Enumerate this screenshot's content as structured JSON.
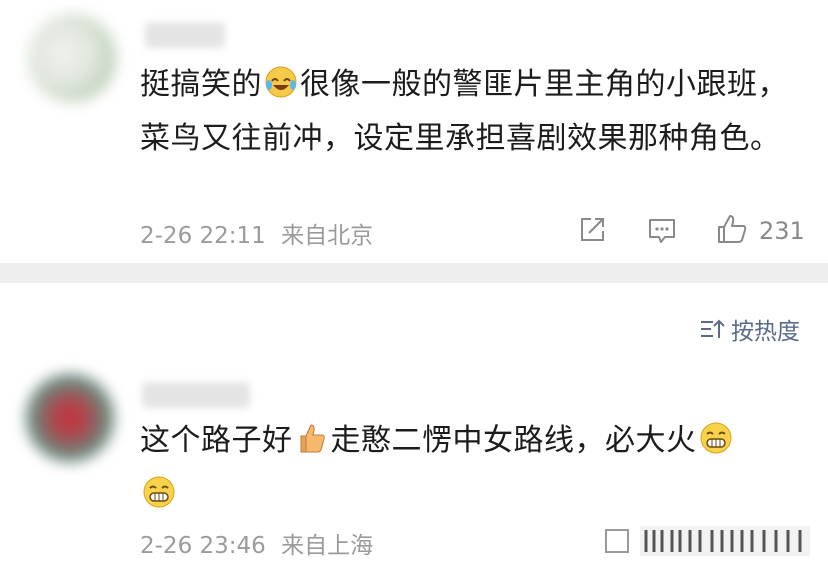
{
  "comments": [
    {
      "text_part1": "挺搞笑的",
      "text_part2": "很像一般的警匪片里主角的小跟班，菜鸟又往前冲，设定里承担喜剧效果那种角色。",
      "time": "2-26 22:11",
      "location": "来自北京",
      "likes": "231"
    },
    {
      "text_part1": "这个路子好",
      "text_part2": "走憨二愣中女路线，必大火",
      "time": "2-26 23:46",
      "location": "来自上海"
    }
  ],
  "sort": {
    "label": "按热度",
    "icon": "sort-icon"
  },
  "icons": [
    "share-icon",
    "comment-icon",
    "like-icon",
    "laugh-tears-emoji",
    "thumbs-up-emoji",
    "grin-emoji"
  ]
}
